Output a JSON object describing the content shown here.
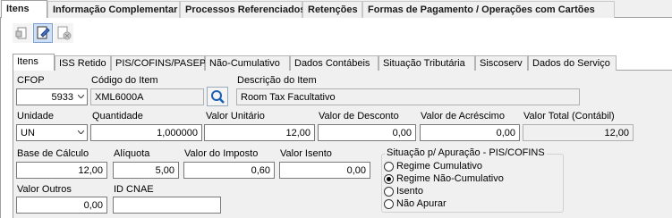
{
  "top_tabs": [
    {
      "label": "Itens"
    },
    {
      "label": "Informação Complementar"
    },
    {
      "label": "Processos Referenciados"
    },
    {
      "label": "Retenções"
    },
    {
      "label": "Formas de Pagamento / Operações com Cartões"
    }
  ],
  "inner_tabs": [
    {
      "label": "Itens"
    },
    {
      "label": "ISS Retido"
    },
    {
      "label": "PIS/COFINS/PASEP"
    },
    {
      "label": "Não-Cumulativo"
    },
    {
      "label": "Dados Contábeis"
    },
    {
      "label": "Situação Tributária"
    },
    {
      "label": "Siscoserv"
    },
    {
      "label": "Dados do Serviço"
    }
  ],
  "form": {
    "cfop": {
      "label": "CFOP",
      "value": "5933"
    },
    "codigo": {
      "label": "Código do Item",
      "value": "XML6000A"
    },
    "descricao": {
      "label": "Descrição do Item",
      "value": "Room Tax Facultativo"
    },
    "unidade": {
      "label": "Unidade",
      "value": "UN"
    },
    "quantidade": {
      "label": "Quantidade",
      "value": "1,000000"
    },
    "valor_unitario": {
      "label": "Valor Unitário",
      "value": "12,00"
    },
    "valor_desconto": {
      "label": "Valor de Desconto",
      "value": "0,00"
    },
    "valor_acrescimo": {
      "label": "Valor de Acréscimo",
      "value": "0,00"
    },
    "valor_total": {
      "label": "Valor Total (Contábil)",
      "value": "12,00"
    },
    "base_calculo": {
      "label": "Base de Cálculo",
      "value": "12,00"
    },
    "aliquota": {
      "label": "Alíquota",
      "value": "5,00"
    },
    "valor_imposto": {
      "label": "Valor do Imposto",
      "value": "0,60"
    },
    "valor_isento": {
      "label": "Valor Isento",
      "value": "0,00"
    },
    "valor_outros": {
      "label": "Valor Outros",
      "value": "0,00"
    },
    "id_cnae": {
      "label": "ID CNAE",
      "value": ""
    }
  },
  "regime": {
    "title": "Situação p/ Apuração - PIS/COFINS",
    "options": [
      {
        "label": "Regime Cumulativo",
        "selected": false
      },
      {
        "label": "Regime Não-Cumulativo",
        "selected": true
      },
      {
        "label": "Isento",
        "selected": false
      },
      {
        "label": "Não Apurar",
        "selected": false
      }
    ]
  },
  "colors": {
    "accent": "#1a5fb4",
    "toolbar_pressed": "#cfe0f4"
  }
}
